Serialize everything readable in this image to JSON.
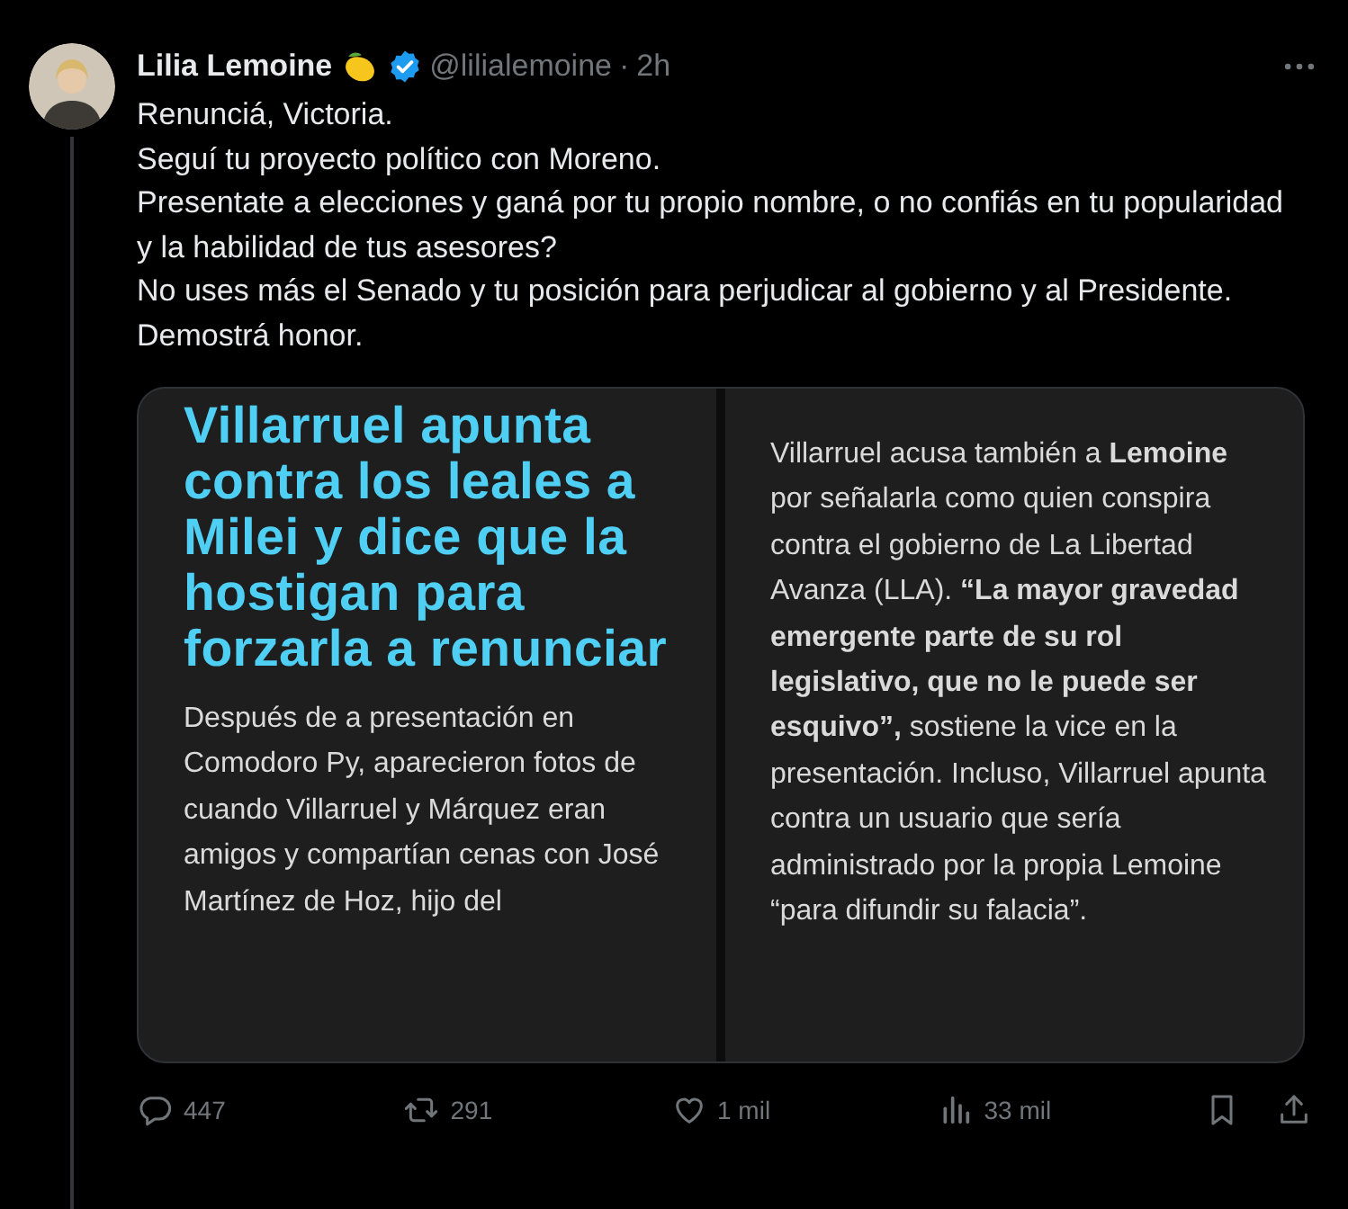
{
  "tweet": {
    "author": {
      "name": "Lilia Lemoine",
      "handle": "@lilialemoine",
      "separator": "·",
      "time": "2h",
      "verified": true
    },
    "text_lines": [
      "Renunciá, Victoria.",
      "Seguí tu proyecto político con Moreno.",
      "Presentate a elecciones y ganá por tu propio nombre, o no confiás en tu popularidad y la habilidad de tus asesores?",
      "No uses más el Senado y tu posición para perjudicar al gobierno y al Presidente.",
      "Demostrá honor."
    ],
    "media": {
      "columns": [
        {
          "headline": "Villarruel apunta contra los leales a Milei y dice que la hostigan para forzarla a renunciar",
          "body": "Después de a presentación en Comodoro Py, aparecieron fotos de cuando Villarruel y Márquez eran amigos y compartían cenas con José Martínez de Hoz, hijo del"
        },
        {
          "body": "Villarruel acusa también a **Lemoine** por señalarla como quien conspira contra el gobierno de La Libertad Avanza (LLA). **“La mayor gravedad emergente parte de su rol legislativo, que no le puede ser esquivo”,** sostiene la vice en la presentación. Incluso, Villarruel apunta contra un usuario que sería administrado por la propia Lemoine “para difundir su falacia”."
        }
      ]
    },
    "actions": [
      {
        "kind": "reply",
        "count": "447"
      },
      {
        "kind": "repost",
        "count": "291"
      },
      {
        "kind": "like",
        "count": "1 mil"
      },
      {
        "kind": "views",
        "count": "33 mil"
      },
      {
        "kind": "bookmark"
      },
      {
        "kind": "share"
      }
    ]
  }
}
